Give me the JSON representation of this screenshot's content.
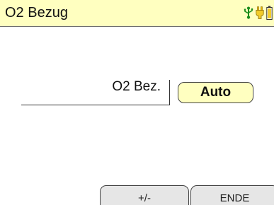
{
  "header": {
    "title": "O2 Bezug",
    "status_icons": [
      "usb-icon",
      "plug-icon",
      "battery-icon"
    ]
  },
  "field": {
    "label": "O2 Bez.",
    "value": "Auto"
  },
  "softkeys": {
    "key1_label": "+/-",
    "key2_label": "ENDE"
  },
  "colors": {
    "title_bar_bg": "#ffffc0",
    "value_button_bg": "#ffffc0",
    "softkey_bg": "#e6e6e6",
    "icon_accent": "#1a8c1a",
    "plug_icon": "#e6b400"
  }
}
